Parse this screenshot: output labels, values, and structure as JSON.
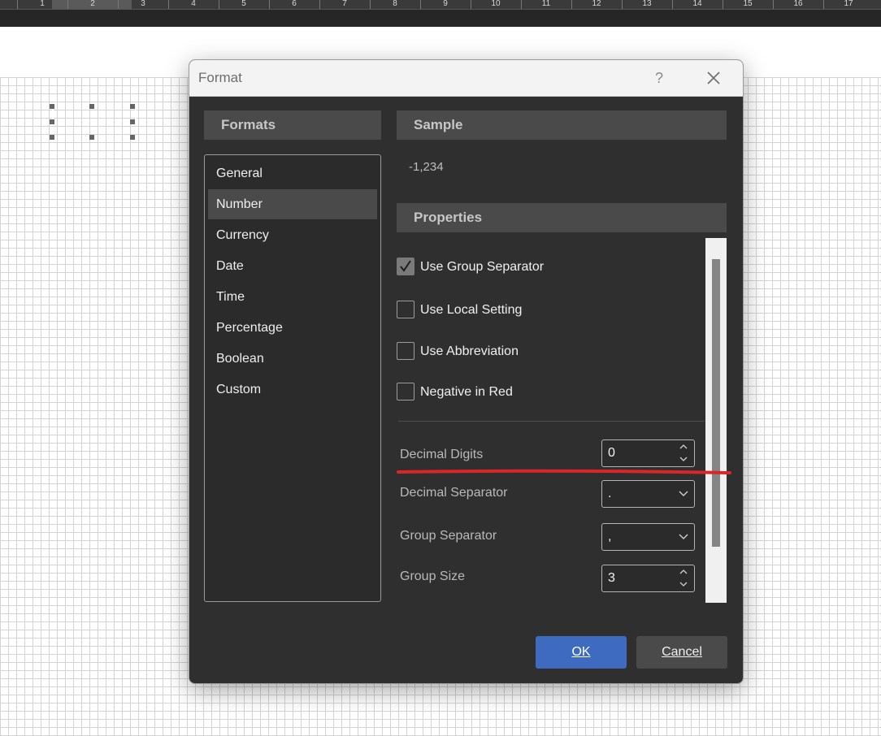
{
  "ruler": {
    "ticks": [
      "1",
      "2",
      "3",
      "4",
      "5",
      "6",
      "7",
      "8",
      "9",
      "10",
      "11",
      "12",
      "13",
      "14",
      "15",
      "16",
      "17"
    ]
  },
  "dialog": {
    "title": "Format",
    "help_glyph": "?",
    "formats_header": "Formats",
    "formats": [
      "General",
      "Number",
      "Currency",
      "Date",
      "Time",
      "Percentage",
      "Boolean",
      "Custom"
    ],
    "selected_format": "Number",
    "sample_header": "Sample",
    "sample_value": "-1,234",
    "properties_header": "Properties",
    "checkboxes": [
      {
        "label": "Use Group Separator",
        "checked": true
      },
      {
        "label": "Use Local Setting",
        "checked": false
      },
      {
        "label": "Use Abbreviation",
        "checked": false
      },
      {
        "label": "Negative in Red",
        "checked": false
      }
    ],
    "fields": {
      "decimal_digits": {
        "label": "Decimal Digits",
        "value": "0"
      },
      "decimal_separator": {
        "label": "Decimal Separator",
        "value": "."
      },
      "group_separator": {
        "label": "Group Separator",
        "value": ","
      },
      "group_size": {
        "label": "Group Size",
        "value": "3"
      }
    },
    "ok_label": "OK",
    "cancel_label": "Cancel"
  },
  "colors": {
    "accent": "#3e6bbf",
    "annotation": "#d92626",
    "dialog_bg": "#2f2f2f"
  }
}
